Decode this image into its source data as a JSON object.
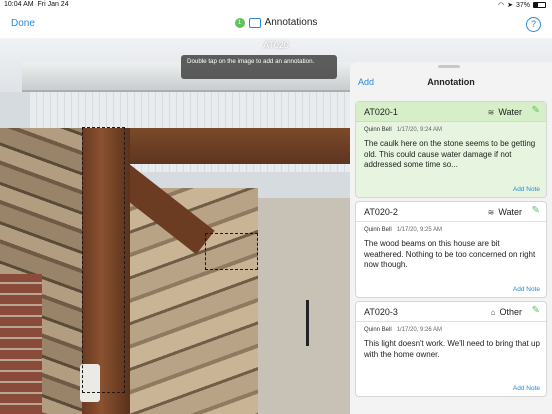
{
  "status_bar": {
    "time": "10:04 AM",
    "date": "Fri Jan 24",
    "battery": "37%"
  },
  "nav": {
    "done_label": "Done",
    "badge_count": "1",
    "title": "Annotations",
    "help_label": "?"
  },
  "photo": {
    "title": "AT020",
    "tip": "Double tap on the image to add an annotation."
  },
  "panel": {
    "add_label": "Add",
    "title": "Annotation",
    "cards": [
      {
        "id": "AT020-1",
        "category": "Water",
        "category_icon": "water-icon",
        "author": "Quinn Bell",
        "timestamp": "1/17/20, 9:24 AM",
        "text": "The caulk here on the stone seems to be getting old. This could cause water damage if not addressed some time so...",
        "add_note": "Add Note",
        "selected": true
      },
      {
        "id": "AT020-2",
        "category": "Water",
        "category_icon": "water-icon",
        "author": "Quinn Bell",
        "timestamp": "1/17/20, 9:25 AM",
        "text": "The wood beams on this house are bit weathered. Nothing to be too concerned on right now though.",
        "add_note": "Add Note",
        "selected": false
      },
      {
        "id": "AT020-3",
        "category": "Other",
        "category_icon": "house-alert-icon",
        "author": "Quinn Bell",
        "timestamp": "1/17/20, 9:26 AM",
        "text": "This light doesn't work. We'll need to bring that up with the home owner.",
        "add_note": "Add Note",
        "selected": false
      }
    ]
  },
  "colors": {
    "accent": "#2a8ad8",
    "success": "#5ec25e",
    "selected_card": "#e7f5e0"
  }
}
